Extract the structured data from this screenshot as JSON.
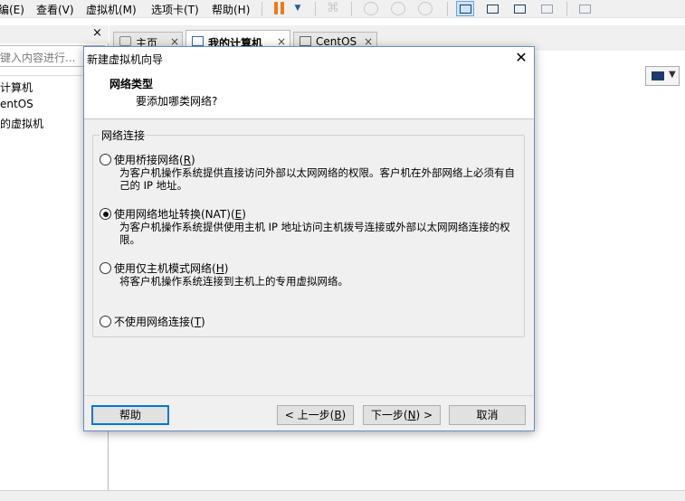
{
  "menubar": {
    "items": [
      "编(E)",
      "查看(V)",
      "虚拟机(M)",
      "选项卡(T)",
      "帮助(H)"
    ]
  },
  "toolbar": {
    "icons": [
      "pause-icon",
      "dropdown-icon",
      "send-keys-icon",
      "snapshot-icon",
      "revert-snapshot-icon",
      "snapshot-manager-icon",
      "library-view-icon",
      "thumbnail-view-icon",
      "fullscreen-icon",
      "unity-icon",
      "console-view-icon"
    ],
    "accent": "#e87a1c"
  },
  "library": {
    "close_label": "×",
    "search_placeholder": "键入内容进行...",
    "items": [
      "计算机",
      "entOS",
      "的虚拟机"
    ]
  },
  "tabs": [
    {
      "label": "主页",
      "close": "×",
      "active": false
    },
    {
      "label": "我的计算机",
      "close": "×",
      "active": true
    },
    {
      "label": "CentOS",
      "close": "×",
      "active": false
    }
  ],
  "dialog": {
    "title": "新建虚拟机向导",
    "close_label": "✕",
    "header_title": "网络类型",
    "header_subtitle": "要添加哪类网络?",
    "group_label": "网络连接",
    "options": [
      {
        "label_pre": "使用桥接网络(",
        "accel": "R",
        "label_post": ")",
        "checked": false,
        "desc": "为客户机操作系统提供直接访问外部以太网网络的权限。客户机在外部网络上必须有自己的 IP 地址。"
      },
      {
        "label_pre": "使用网络地址转换(NAT)(",
        "accel": "E",
        "label_post": ")",
        "checked": true,
        "desc": "为客户机操作系统提供使用主机 IP 地址访问主机拨号连接或外部以太网网络连接的权限。"
      },
      {
        "label_pre": "使用仅主机模式网络(",
        "accel": "H",
        "label_post": ")",
        "checked": false,
        "desc": "将客户机操作系统连接到主机上的专用虚拟网络。"
      },
      {
        "label_pre": "不使用网络连接(",
        "accel": "T",
        "label_post": ")",
        "checked": false,
        "desc": ""
      }
    ],
    "buttons": {
      "help": "帮助",
      "back_pre": "< 上一步(",
      "back_accel": "B",
      "back_post": ")",
      "next_pre": "下一步(",
      "next_accel": "N",
      "next_post": ") >",
      "cancel": "取消"
    },
    "border_color": "#6a8fbf",
    "focus_color": "#0078d7"
  }
}
